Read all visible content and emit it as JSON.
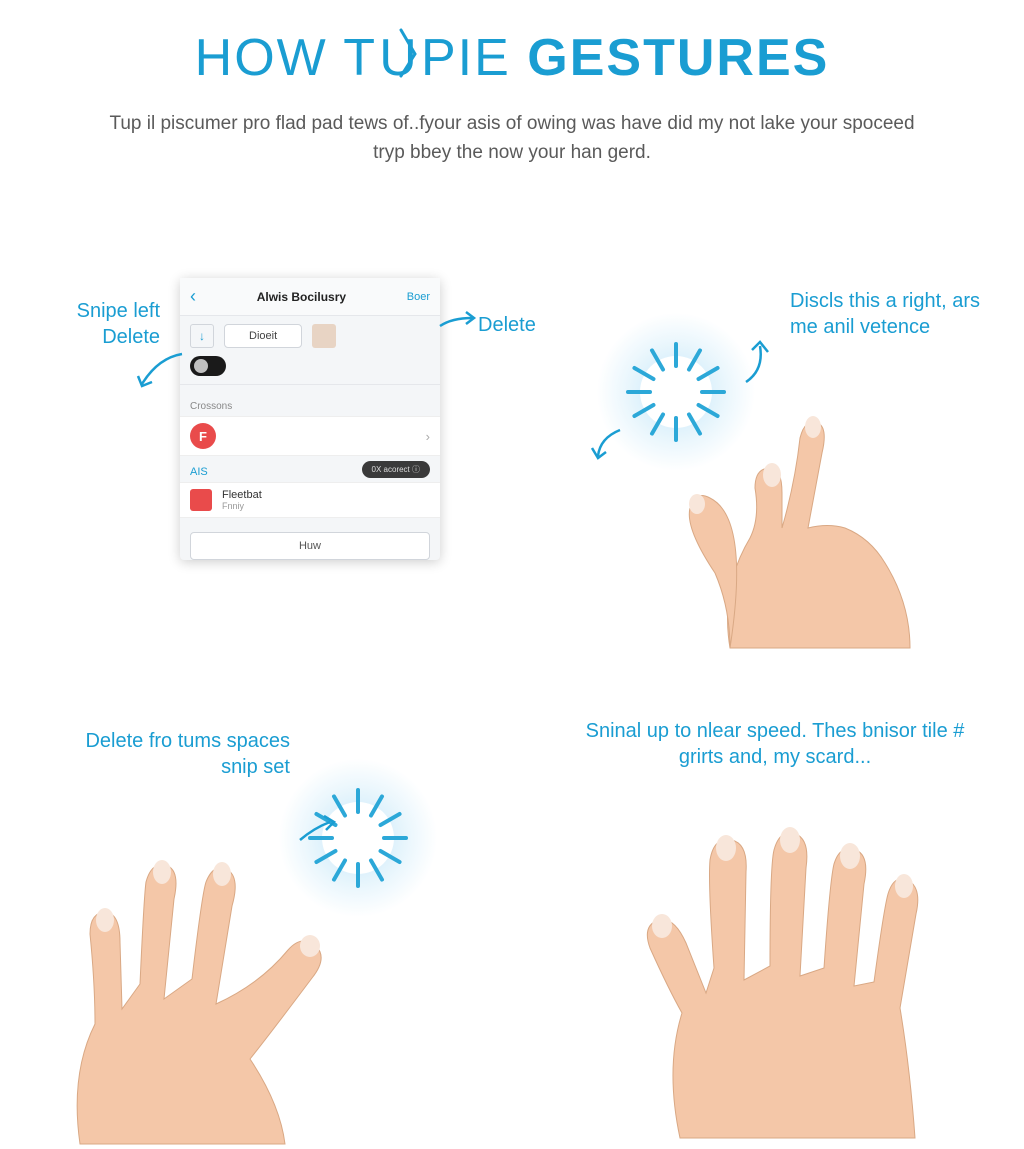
{
  "title": {
    "part1": "HOW T",
    "part2": "PIE",
    "part3": "GESTURES"
  },
  "subtitle": "Tup il piscumer pro flad pad tews of..fyour asis of owing was have did my not lake your spoceed tryp bbey the now your han gerd.",
  "phone": {
    "back_glyph": "‹",
    "title": "Alwis Bocilusry",
    "action": "Boer",
    "btn1_glyph": "↓",
    "btn_center": "Dioeit",
    "section1": "Crossons",
    "section2": "AIS",
    "pill": "0X   acorect  ⓘ",
    "item_title": "Fleetbat",
    "item_sub": "Fnniy",
    "footer_btn": "Huw"
  },
  "callouts": {
    "swipe_left": "Snipe left Delete",
    "delete": "Delete",
    "top_right": "Discls this a right, ars me anil vetence",
    "bottom_left": "Delete fro tums spaces snip set",
    "bottom_right": "Sninal up to nlear speed. Thes bnisor tile # grirts and, my scard..."
  },
  "colors": {
    "accent": "#1a9dd2",
    "skin": "#f4c7a8",
    "nail": "#f8e6da"
  }
}
